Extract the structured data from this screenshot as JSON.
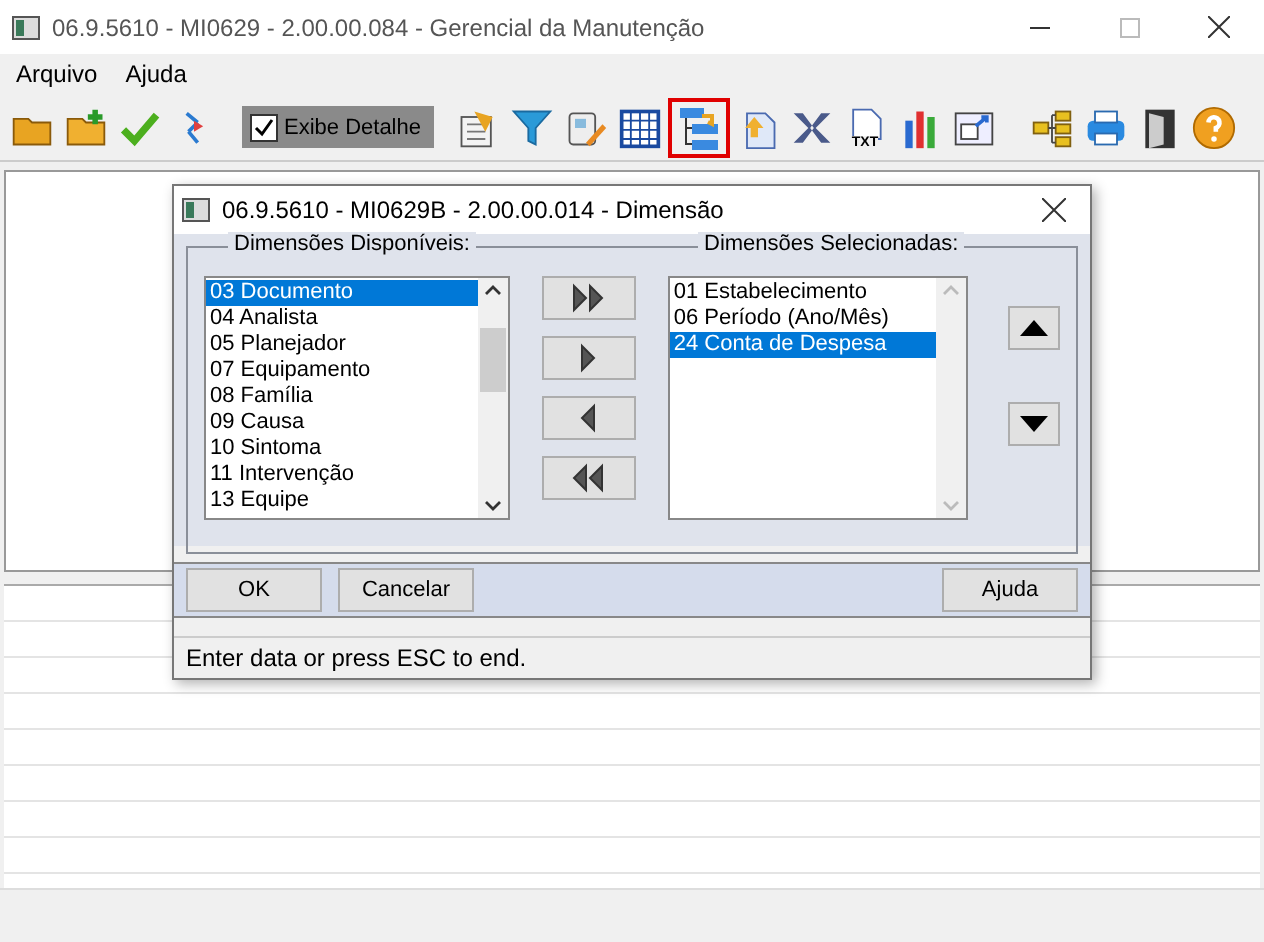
{
  "window": {
    "title": "06.9.5610 - MI0629 - 2.00.00.084 - Gerencial da Manutenção"
  },
  "menu": [
    "Arquivo",
    "Ajuda"
  ],
  "toolbar": {
    "items": [
      {
        "kind": "folder",
        "selected": false
      },
      {
        "kind": "new-folder",
        "selected": false
      },
      {
        "kind": "check",
        "selected": false
      },
      {
        "kind": "swap",
        "selected": false
      },
      {
        "kind": "checkbox",
        "label": "Exibe Detalhe",
        "checked": true
      },
      {
        "kind": "report",
        "selected": false
      },
      {
        "kind": "filter",
        "selected": false
      },
      {
        "kind": "edit",
        "selected": false
      },
      {
        "kind": "calendar",
        "selected": false
      },
      {
        "kind": "tree",
        "selected": true
      },
      {
        "kind": "upload",
        "selected": false
      },
      {
        "kind": "excel",
        "selected": false
      },
      {
        "kind": "txt",
        "label": "TXT",
        "selected": false
      },
      {
        "kind": "chart",
        "selected": false
      },
      {
        "kind": "window",
        "selected": false
      },
      {
        "kind": "hierarchy",
        "selected": false
      },
      {
        "kind": "print",
        "selected": false
      },
      {
        "kind": "exit",
        "selected": false
      },
      {
        "kind": "help",
        "selected": false
      }
    ]
  },
  "dialog": {
    "title": "06.9.5610 - MI0629B - 2.00.00.014 - Dimensão",
    "available": {
      "label": "Dimensões Disponíveis:",
      "items": [
        {
          "text": "03 Documento",
          "selected": true
        },
        {
          "text": "04 Analista",
          "selected": false
        },
        {
          "text": "05 Planejador",
          "selected": false
        },
        {
          "text": "07 Equipamento",
          "selected": false
        },
        {
          "text": "08 Família",
          "selected": false
        },
        {
          "text": "09 Causa",
          "selected": false
        },
        {
          "text": "10 Sintoma",
          "selected": false
        },
        {
          "text": "11 Intervenção",
          "selected": false
        },
        {
          "text": "13 Equipe",
          "selected": false
        }
      ]
    },
    "selected_list": {
      "label": "Dimensões Selecionadas:",
      "items": [
        {
          "text": "01 Estabelecimento",
          "selected": false
        },
        {
          "text": "06 Período (Ano/Mês)",
          "selected": false
        },
        {
          "text": "24 Conta de Despesa",
          "selected": true
        }
      ]
    },
    "buttons": [
      "OK",
      "Cancelar"
    ],
    "help_button": "Ajuda",
    "status": "Enter data or press ESC to end."
  }
}
